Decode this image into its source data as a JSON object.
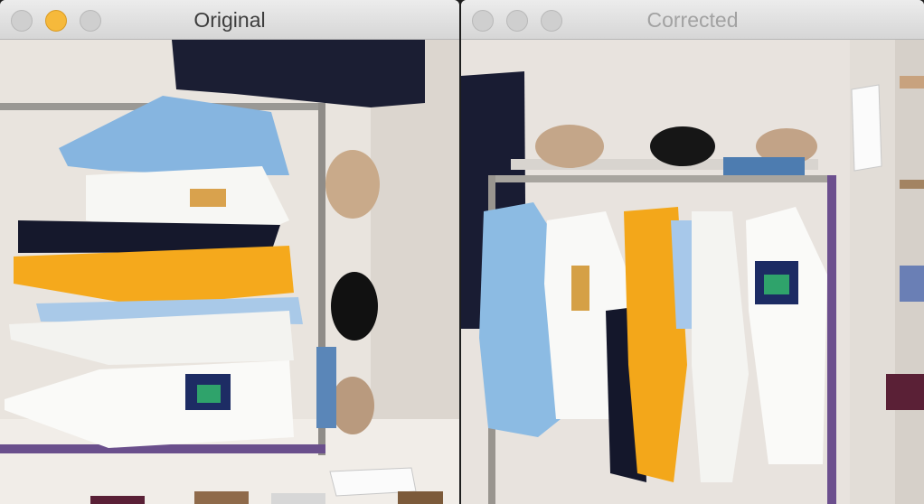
{
  "windows": {
    "original": {
      "title": "Original",
      "focused": true
    },
    "corrected": {
      "title": "Corrected",
      "focused": false
    }
  },
  "images": {
    "original": {
      "description_icon": "rotated-clothing-rack-photo"
    },
    "corrected": {
      "description_icon": "upright-clothing-rack-photo"
    }
  },
  "colors": {
    "accent_light": "#f6b93b",
    "inactive_light": "#cfcfcf"
  }
}
